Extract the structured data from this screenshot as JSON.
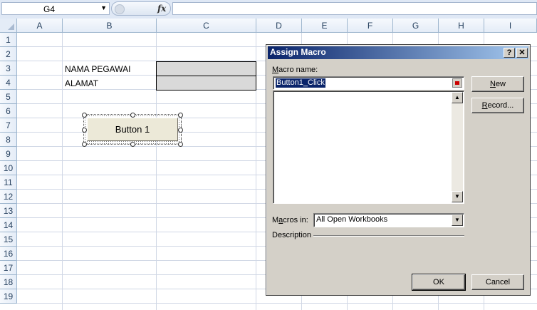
{
  "formula_bar": {
    "name_box": "G4",
    "fx_label": "fx",
    "formula": ""
  },
  "columns": [
    "A",
    "B",
    "C",
    "D",
    "E",
    "F",
    "G",
    "H",
    "I"
  ],
  "rows": [
    "1",
    "2",
    "3",
    "4",
    "5",
    "6",
    "7",
    "8",
    "9",
    "10",
    "11",
    "12",
    "13",
    "14",
    "15",
    "16",
    "17",
    "18",
    "19"
  ],
  "cells": {
    "B3": "NAMA PEGAWAI",
    "B4": "ALAMAT"
  },
  "form_button": {
    "label": "Button 1"
  },
  "dialog": {
    "title": "Assign Macro",
    "help_glyph": "?",
    "close_glyph": "✕",
    "macro_name_label_underlined": "M",
    "macro_name_label_rest": "acro name:",
    "macro_name_value": "Button1_Click",
    "macro_list": [],
    "macros_in_label_pre": "M",
    "macros_in_label_underlined": "a",
    "macros_in_label_rest": "cros in:",
    "macros_in_value": "All Open Workbooks",
    "description_label": "Description",
    "buttons": {
      "new_underlined": "N",
      "new_rest": "ew",
      "record_underlined": "R",
      "record_rest": "ecord...",
      "ok": "OK",
      "cancel": "Cancel"
    }
  }
}
